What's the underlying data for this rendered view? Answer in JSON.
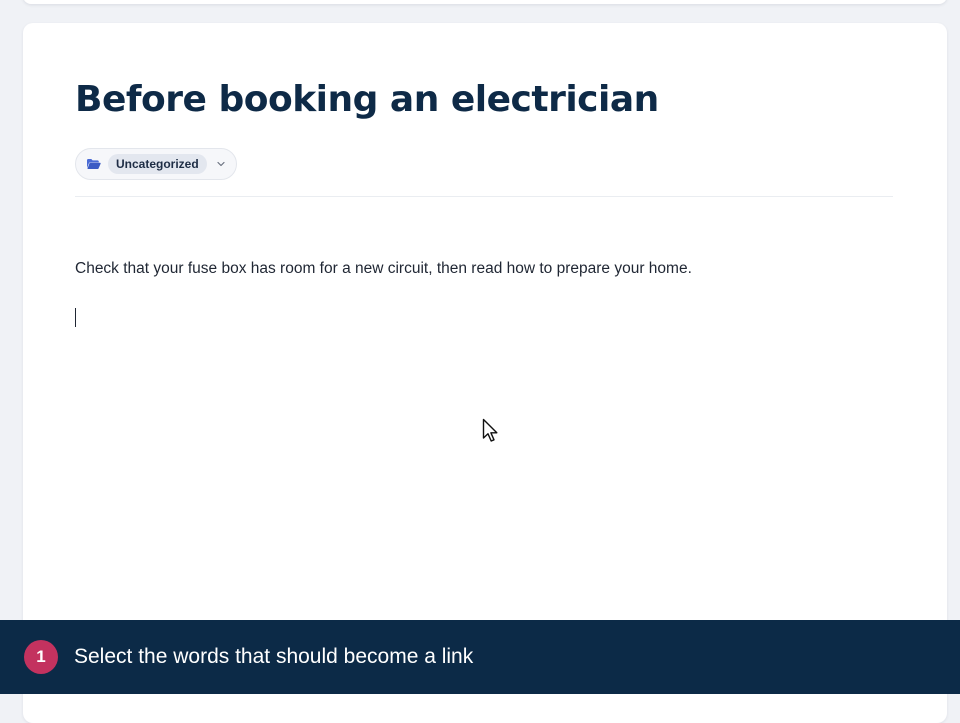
{
  "document": {
    "title": "Before booking an electrician",
    "category": {
      "label": "Uncategorized",
      "icon": "folder-open-icon",
      "dropdown_icon": "chevron-down-icon"
    },
    "body_text": "Check that your fuse box has room for a new circuit, then read how to prepare your home."
  },
  "instruction": {
    "step": "1",
    "text": "Select the words that should become a link"
  },
  "colors": {
    "title": "#0e2a47",
    "accent_folder": "#4a6bd6",
    "instruction_bar": "#0c2a47",
    "step_badge": "#c3325f"
  }
}
